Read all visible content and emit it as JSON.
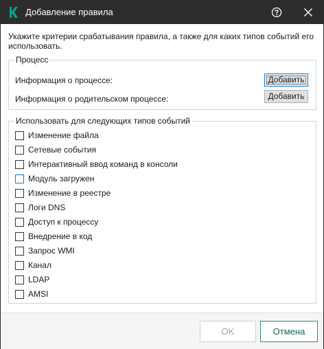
{
  "titlebar": {
    "title": "Добавление правила",
    "app_icon": "kaspersky-k-icon",
    "brand_color": "#00a88e",
    "help_icon": "help-icon",
    "close_icon": "close-icon"
  },
  "intro_text": "Укажите критерии срабатывания правила, а также для каких типов событий его использовать.",
  "process_group": {
    "legend": "Процесс",
    "rows": [
      {
        "label": "Информация о процессе:",
        "button": "Добавить"
      },
      {
        "label": "Информация о родительском процессе:",
        "button": "Добавить"
      }
    ]
  },
  "events_group": {
    "legend": "Использовать для следующих типов событий",
    "items": [
      {
        "label": "Изменение файла",
        "checked": false
      },
      {
        "label": "Сетевые события",
        "checked": false
      },
      {
        "label": "Интерактивный ввод команд в консоли",
        "checked": false
      },
      {
        "label": "Модуль загружен",
        "checked": false
      },
      {
        "label": "Изменение в реестре",
        "checked": false
      },
      {
        "label": "Логи DNS",
        "checked": false
      },
      {
        "label": "Доступ к процессу",
        "checked": false
      },
      {
        "label": "Внедрение в код",
        "checked": false
      },
      {
        "label": "Запрос WMI",
        "checked": false
      },
      {
        "label": "Канал",
        "checked": false
      },
      {
        "label": "LDAP",
        "checked": false
      },
      {
        "label": "AMSI",
        "checked": false
      }
    ]
  },
  "footer": {
    "ok_label": "OK",
    "cancel_label": "Отмена",
    "accent_color": "#17665a"
  }
}
